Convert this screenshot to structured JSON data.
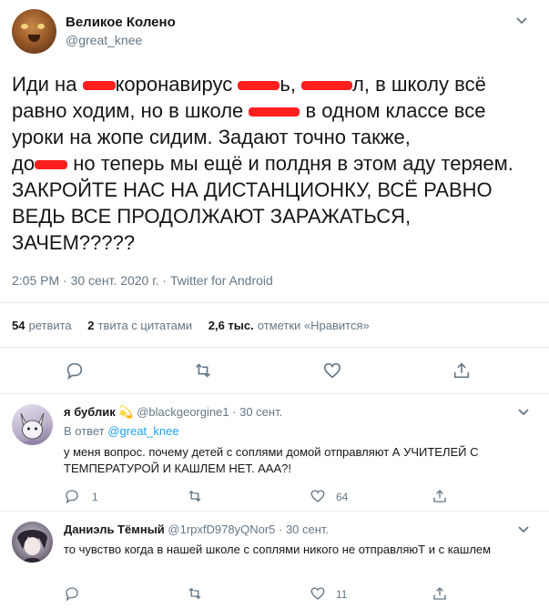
{
  "tweet": {
    "author_name": "Великое Колено",
    "author_handle": "@great_knee",
    "text_part1": "Иди на ",
    "text_part2": "коронавирус ",
    "text_part3": "ь, ",
    "text_part4": "л, в школу всё равно ходим, но в школе ",
    "text_part5": " в одном классе все уроки на жопе сидим. Задают точно также,",
    "text_part6": "до",
    "text_part7": " но теперь мы ещё и полдня в этом аду теряем.",
    "text_caps": "ЗАКРОЙТЕ НАС НА ДИСТАНЦИОНКУ, ВСЁ РАВНО ВЕДЬ ВСЕ ПРОДОЛЖАЮТ ЗАРАЖАТЬСЯ, ЗАЧЕМ?????",
    "meta": "2:05 PM · 30 сент. 2020 г. · Twitter for Android",
    "redaction_color": "#ff1f1f"
  },
  "stats": {
    "retweets_count": "54",
    "retweets_label": "ретвита",
    "quotes_count": "2",
    "quotes_label": "твита с цитатами",
    "likes_count": "2,6 тыс.",
    "likes_label": "отметки «Нравится»"
  },
  "icons": {
    "reply": "comment-icon",
    "retweet": "retweet-icon",
    "like": "heart-icon",
    "share": "share-icon",
    "more": "chevron-down-icon"
  },
  "replies": [
    {
      "name": "я бублик",
      "emoji": "💫",
      "handle": "@blackgeorgine1 · 30 сент.",
      "reply_to_label": "В ответ",
      "reply_to_handle": "@great_knee",
      "text": "у меня вопрос. почему детей с соплями домой отправляют А УЧИТЕЛЕЙ С ТЕМПЕРАТУРОЙ И КАШЛЕМ НЕТ. ААА?!",
      "reply_count": "1",
      "like_count": "64"
    },
    {
      "name": "Даниэль Тёмный",
      "handle": "@1rpxfD978yQNor5 · 30 сент.",
      "text": "то чувство когда в нашей школе с соплями никого не отправляюТ и с кашлем",
      "like_count": "11"
    }
  ],
  "colors": {
    "text": "#14171a",
    "secondary": "#657786",
    "link": "#1da1f2",
    "divider": "#e6ecf0"
  }
}
